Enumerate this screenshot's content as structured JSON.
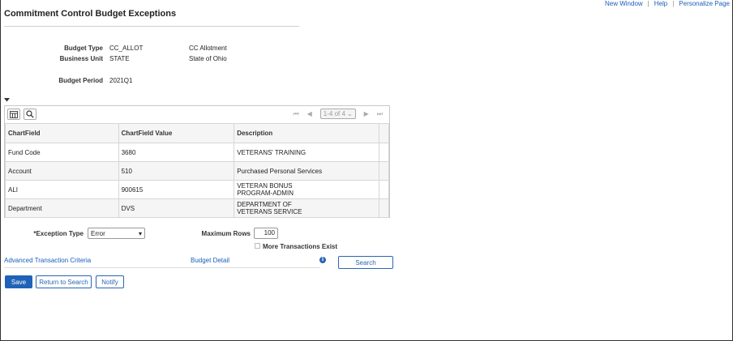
{
  "topbar": {
    "new_window": "New Window",
    "help": "Help",
    "personalize": "Personalize Page"
  },
  "page": {
    "title": "Commitment Control Budget Exceptions"
  },
  "header_fields": {
    "budget_type_label": "Budget Type",
    "budget_type_value": "CC_ALLOT",
    "budget_type_desc": "CC Allotment",
    "business_unit_label": "Business Unit",
    "business_unit_value": "STATE",
    "business_unit_desc": "State of Ohio",
    "budget_period_label": "Budget Period",
    "budget_period_value": "2021Q1"
  },
  "grid": {
    "pager_text": "1-4 of 4",
    "columns": [
      "ChartField",
      "ChartField Value",
      "Description"
    ],
    "rows": [
      {
        "field": "Fund Code",
        "value": "3680",
        "desc": "VETERANS' TRAINING"
      },
      {
        "field": "Account",
        "value": "510",
        "desc": "Purchased Personal Services"
      },
      {
        "field": "ALI",
        "value": "900615",
        "desc": "VETERAN BONUS PROGRAM-ADMIN"
      },
      {
        "field": "Department",
        "value": "DVS",
        "desc": "DEPARTMENT OF VETERANS SERVICE"
      }
    ]
  },
  "filters": {
    "exception_type_label": "*Exception Type",
    "exception_type_value": "Error",
    "max_rows_label": "Maximum Rows",
    "max_rows_value": "100",
    "more_transactions_label": "More Transactions Exist"
  },
  "links": {
    "advanced_criteria": "Advanced Transaction Criteria",
    "budget_detail": "Budget Detail"
  },
  "buttons": {
    "search": "Search",
    "save": "Save",
    "return_to_search": "Return to Search",
    "notify": "Notify"
  },
  "colors": {
    "link": "#1b5fb8",
    "primary_button": "#1f63b8"
  }
}
